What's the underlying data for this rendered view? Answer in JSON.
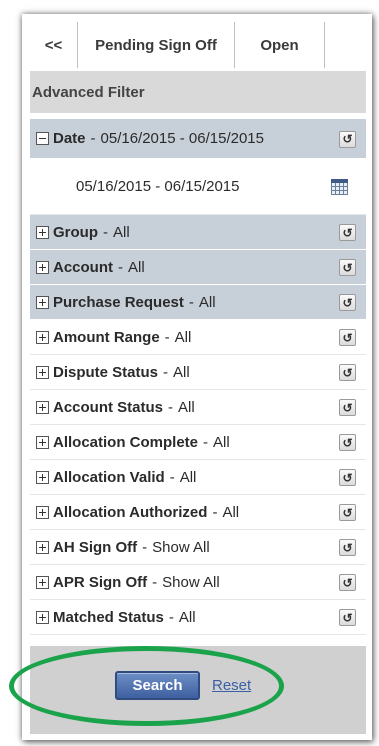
{
  "tabs": [
    {
      "label": "<<"
    },
    {
      "label": "Pending Sign Off"
    },
    {
      "label": "Open"
    },
    {
      "label": ""
    }
  ],
  "advanced_filter": {
    "title": "Advanced Filter"
  },
  "date_filter": {
    "title": "Date",
    "separator": "-",
    "value": "05/16/2015 - 06/15/2015",
    "range_input_value": "05/16/2015 - 06/15/2015",
    "reset_symbol": "↺",
    "calendar_icon": "calendar-icon"
  },
  "filters": [
    {
      "title": "Group",
      "value": "All",
      "shaded": true
    },
    {
      "title": "Account",
      "value": "All",
      "shaded": true
    },
    {
      "title": "Purchase Request",
      "value": "All",
      "shaded": true
    },
    {
      "title": "Amount Range",
      "value": "All",
      "shaded": false
    },
    {
      "title": "Dispute Status",
      "value": "All",
      "shaded": false
    },
    {
      "title": "Account Status",
      "value": "All",
      "shaded": false
    },
    {
      "title": "Allocation Complete",
      "value": "All",
      "shaded": false
    },
    {
      "title": "Allocation Valid",
      "value": "All",
      "shaded": false
    },
    {
      "title": "Allocation Authorized",
      "value": "All",
      "shaded": false
    },
    {
      "title": "AH Sign Off",
      "value": "Show All",
      "shaded": false
    },
    {
      "title": "APR Sign Off",
      "value": "Show All",
      "shaded": false
    },
    {
      "title": "Matched Status",
      "value": "All",
      "shaded": false
    }
  ],
  "footer": {
    "search_label": "Search",
    "reset_label": "Reset"
  },
  "colors": {
    "header_band": "#c7cfd9",
    "advanced_filter_bg": "#d9d9d9",
    "footer_bg": "#d0d0d0",
    "search_button": "#3e5fa0",
    "highlight": "#1aa34a"
  }
}
